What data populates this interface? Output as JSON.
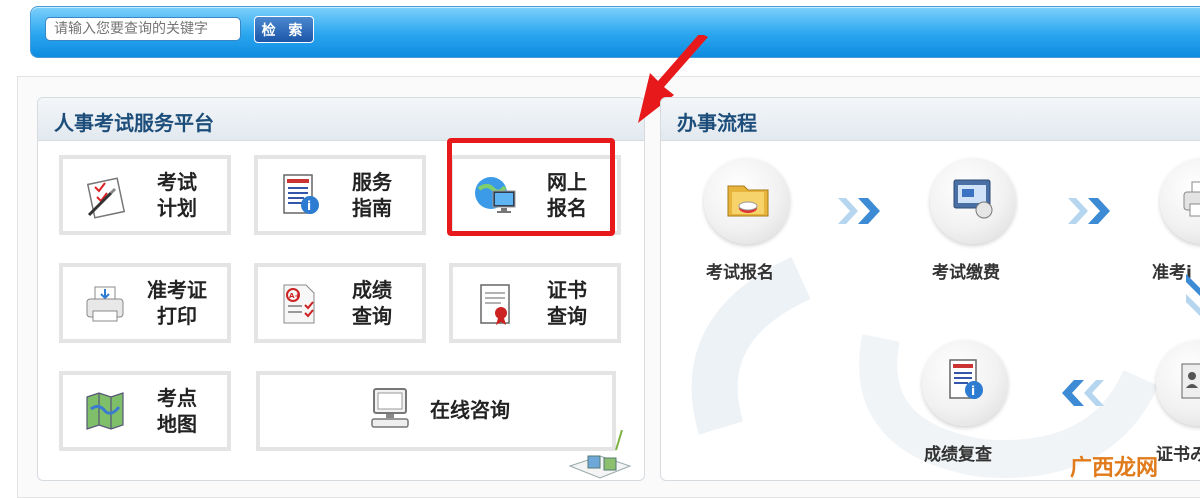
{
  "search": {
    "placeholder": "请输入您要查询的关键字",
    "button_label": "检 索"
  },
  "left_panel": {
    "title": "人事考试服务平台",
    "tiles": [
      {
        "line1": "考试",
        "line2": "计划",
        "icon": "exam-plan-icon"
      },
      {
        "line1": "服务",
        "line2": "指南",
        "icon": "service-guide-icon"
      },
      {
        "line1": "网上",
        "line2": "报名",
        "icon": "online-registration-icon"
      },
      {
        "line1": "准考证",
        "line2": "打印",
        "icon": "printer-icon"
      },
      {
        "line1": "成绩",
        "line2": "查询",
        "icon": "score-query-icon"
      },
      {
        "line1": "证书",
        "line2": "查询",
        "icon": "certificate-icon"
      },
      {
        "line1": "考点",
        "line2": "地图",
        "icon": "map-icon"
      },
      {
        "line1": "在线咨询",
        "icon": "computer-icon"
      }
    ]
  },
  "right_panel": {
    "title": "办事流程",
    "steps": [
      {
        "label": "考试报名",
        "icon": "folder-icon"
      },
      {
        "label": "考试缴费",
        "icon": "payment-icon"
      },
      {
        "label": "准考i",
        "icon": "printer-icon"
      },
      {
        "label": "成绩复查",
        "icon": "document-info-icon"
      },
      {
        "label": "证书み",
        "icon": "certificate-photo-icon"
      }
    ]
  },
  "annotation": {
    "arrow_color": "#e8191a",
    "highlight_color": "#e8191a"
  },
  "watermark": "广西龙网"
}
